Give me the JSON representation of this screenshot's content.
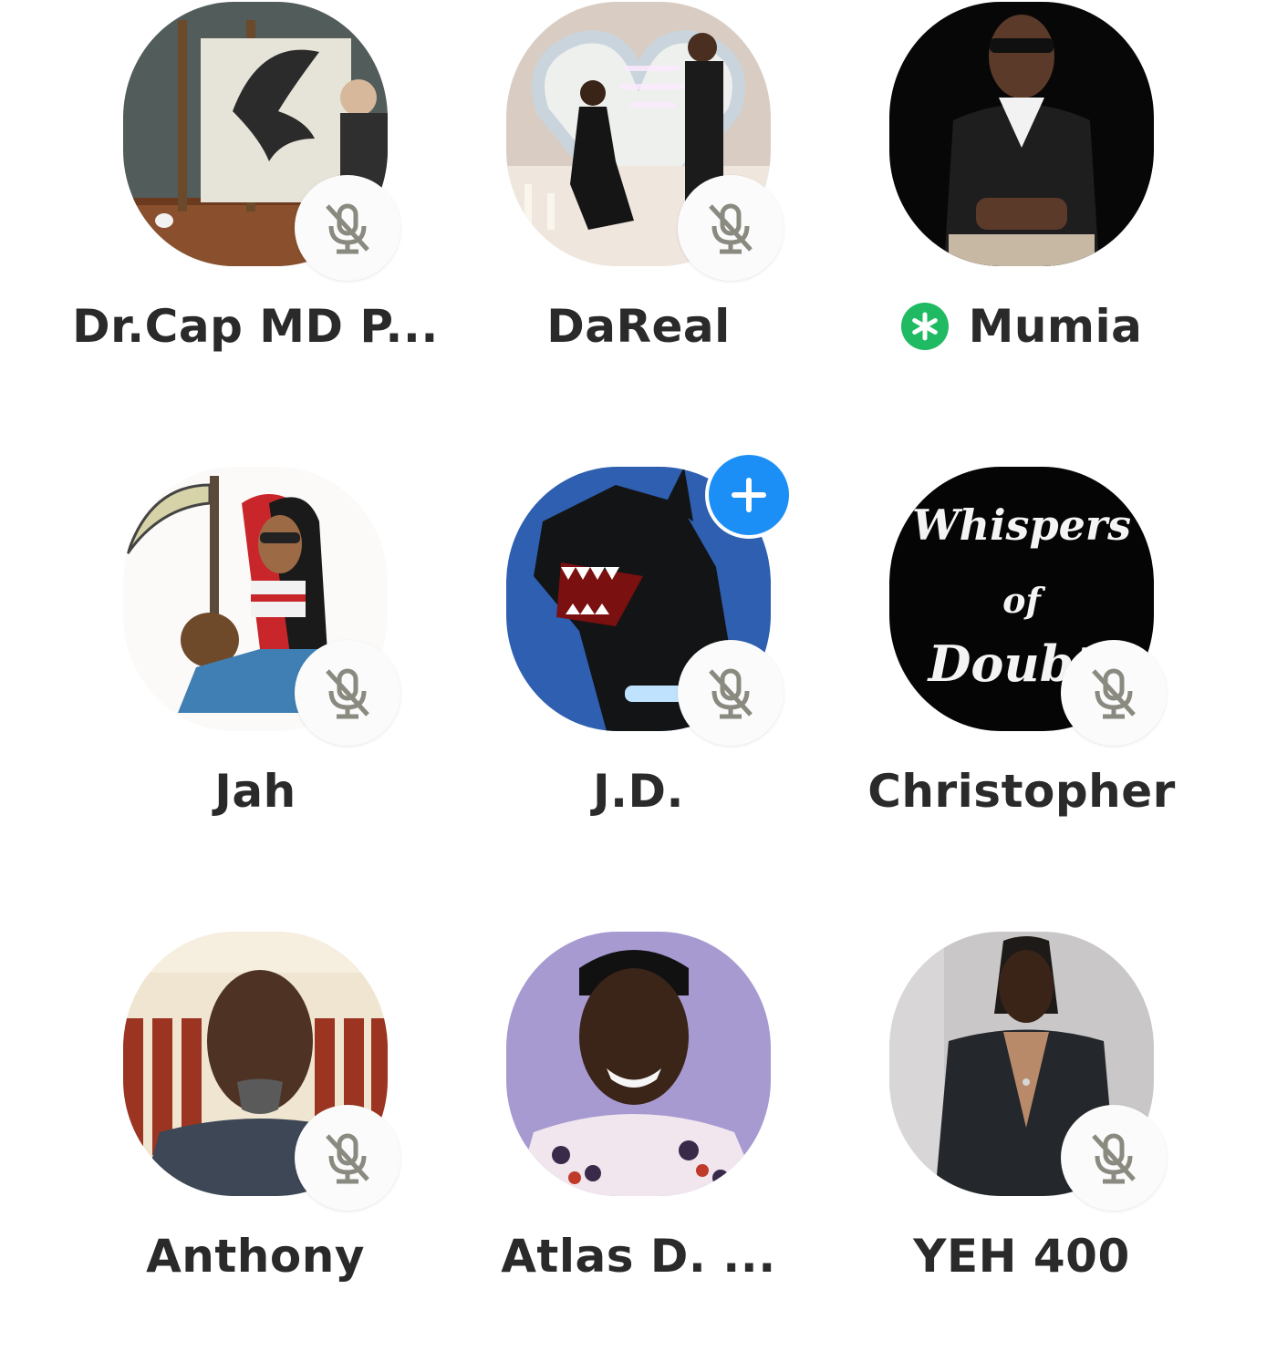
{
  "room": {
    "speakers": [
      {
        "name": "Dr.Cap MD P...",
        "photo": "surrealist painter painting a bird",
        "muted": true,
        "moderator": false,
        "follow_available": false
      },
      {
        "name": "DaReal",
        "photo": "marriage proposal with neon sign",
        "muted": true,
        "moderator": false,
        "follow_available": false
      },
      {
        "name": "Mumia",
        "photo": "man in sunglasses and dark cardigan",
        "muted": false,
        "moderator": true,
        "follow_available": false
      },
      {
        "name": "Jah",
        "photo": "cartoon girl with scythe and handbag",
        "muted": true,
        "moderator": false,
        "follow_available": false
      },
      {
        "name": "J.D.",
        "photo": "snarling doberman on blue background",
        "muted": true,
        "moderator": false,
        "follow_available": true
      },
      {
        "name": "Christopher",
        "photo": "chalk text Whispers of Doubt",
        "photo_text": [
          "Whispers",
          "of",
          "Doubt"
        ],
        "muted": true,
        "moderator": false,
        "follow_available": false
      },
      {
        "name": "Anthony",
        "photo": "man with goatee in front of red curtains",
        "muted": true,
        "moderator": false,
        "follow_available": false
      },
      {
        "name": "Atlas D. ...",
        "photo": "smiling young man in patterned shirt",
        "muted": true,
        "moderator": false,
        "follow_available": false
      },
      {
        "name": "YEH 400",
        "photo": "man with locs in dark blazer",
        "muted": true,
        "moderator": false,
        "follow_available": false
      }
    ]
  },
  "icons": {
    "muted": "microphone-off-icon",
    "moderator": "asterisk-icon",
    "follow": "plus-icon"
  },
  "colors": {
    "name_text": "#2a2a2a",
    "mute_icon": "#8a8a80",
    "moderator_badge": "#1fba62",
    "follow_badge": "#1b8ff5",
    "background": "#ffffff"
  }
}
